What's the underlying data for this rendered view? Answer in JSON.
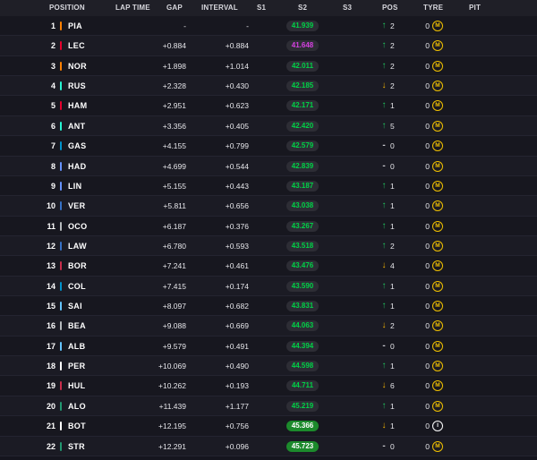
{
  "header": {
    "position": "POSITION",
    "lap_time": "LAP TIME",
    "gap": "GAP",
    "interval": "INTERVAL",
    "s1": "S1",
    "s2": "S2",
    "s3": "S3",
    "pos": "POS",
    "tyre": "TYRE",
    "pit": "PIT"
  },
  "colors": {
    "background": "#15151e",
    "accent": "#e10600",
    "sector_green": "#00d247",
    "sector_purple": "#d440e0",
    "up": "#21c25e",
    "down": "#f5b400",
    "tyre_medium": "#f2c200"
  },
  "rows": [
    {
      "pos": "1",
      "driver": "PIA",
      "team_color": "#ff8000",
      "gap": "-",
      "interval": "-",
      "s2": "41.939",
      "s2_style": "green",
      "dir": "up",
      "arrow": "↑",
      "pos_change": "2",
      "tyre_age": "0",
      "tyre": "M",
      "tyre_icon": "medium-tyre-icon"
    },
    {
      "pos": "2",
      "driver": "LEC",
      "team_color": "#e8002d",
      "gap": "+0.884",
      "interval": "+0.884",
      "s2": "41.648",
      "s2_style": "purple",
      "dir": "up",
      "arrow": "↑",
      "pos_change": "2",
      "tyre_age": "0",
      "tyre": "M",
      "tyre_icon": "medium-tyre-icon"
    },
    {
      "pos": "3",
      "driver": "NOR",
      "team_color": "#ff8000",
      "gap": "+1.898",
      "interval": "+1.014",
      "s2": "42.011",
      "s2_style": "green",
      "dir": "up",
      "arrow": "↑",
      "pos_change": "2",
      "tyre_age": "0",
      "tyre": "M",
      "tyre_icon": "medium-tyre-icon"
    },
    {
      "pos": "4",
      "driver": "RUS",
      "team_color": "#27f4d2",
      "gap": "+2.328",
      "interval": "+0.430",
      "s2": "42.185",
      "s2_style": "green",
      "dir": "down",
      "arrow": "↓",
      "pos_change": "2",
      "tyre_age": "0",
      "tyre": "M",
      "tyre_icon": "medium-tyre-icon"
    },
    {
      "pos": "5",
      "driver": "HAM",
      "team_color": "#e8002d",
      "gap": "+2.951",
      "interval": "+0.623",
      "s2": "42.171",
      "s2_style": "green",
      "dir": "up",
      "arrow": "↑",
      "pos_change": "1",
      "tyre_age": "0",
      "tyre": "M",
      "tyre_icon": "medium-tyre-icon"
    },
    {
      "pos": "6",
      "driver": "ANT",
      "team_color": "#27f4d2",
      "gap": "+3.356",
      "interval": "+0.405",
      "s2": "42.420",
      "s2_style": "green",
      "dir": "up",
      "arrow": "↑",
      "pos_change": "5",
      "tyre_age": "0",
      "tyre": "M",
      "tyre_icon": "medium-tyre-icon"
    },
    {
      "pos": "7",
      "driver": "GAS",
      "team_color": "#0093cc",
      "gap": "+4.155",
      "interval": "+0.799",
      "s2": "42.579",
      "s2_style": "green",
      "dir": "none",
      "arrow": "-",
      "pos_change": "0",
      "tyre_age": "0",
      "tyre": "M",
      "tyre_icon": "medium-tyre-icon"
    },
    {
      "pos": "8",
      "driver": "HAD",
      "team_color": "#6692ff",
      "gap": "+4.699",
      "interval": "+0.544",
      "s2": "42.839",
      "s2_style": "green",
      "dir": "none",
      "arrow": "-",
      "pos_change": "0",
      "tyre_age": "0",
      "tyre": "M",
      "tyre_icon": "medium-tyre-icon"
    },
    {
      "pos": "9",
      "driver": "LIN",
      "team_color": "#6692ff",
      "gap": "+5.155",
      "interval": "+0.443",
      "s2": "43.187",
      "s2_style": "green",
      "dir": "up",
      "arrow": "↑",
      "pos_change": "1",
      "tyre_age": "0",
      "tyre": "M",
      "tyre_icon": "medium-tyre-icon"
    },
    {
      "pos": "10",
      "driver": "VER",
      "team_color": "#3671c6",
      "gap": "+5.811",
      "interval": "+0.656",
      "s2": "43.038",
      "s2_style": "green",
      "dir": "up",
      "arrow": "↑",
      "pos_change": "1",
      "tyre_age": "0",
      "tyre": "M",
      "tyre_icon": "medium-tyre-icon"
    },
    {
      "pos": "11",
      "driver": "OCO",
      "team_color": "#b6babd",
      "gap": "+6.187",
      "interval": "+0.376",
      "s2": "43.267",
      "s2_style": "green",
      "dir": "up",
      "arrow": "↑",
      "pos_change": "1",
      "tyre_age": "0",
      "tyre": "M",
      "tyre_icon": "medium-tyre-icon"
    },
    {
      "pos": "12",
      "driver": "LAW",
      "team_color": "#3671c6",
      "gap": "+6.780",
      "interval": "+0.593",
      "s2": "43.518",
      "s2_style": "green",
      "dir": "up",
      "arrow": "↑",
      "pos_change": "2",
      "tyre_age": "0",
      "tyre": "M",
      "tyre_icon": "medium-tyre-icon"
    },
    {
      "pos": "13",
      "driver": "BOR",
      "team_color": "#c92d4b",
      "gap": "+7.241",
      "interval": "+0.461",
      "s2": "43.476",
      "s2_style": "green",
      "dir": "down",
      "arrow": "↓",
      "pos_change": "4",
      "tyre_age": "0",
      "tyre": "M",
      "tyre_icon": "medium-tyre-icon"
    },
    {
      "pos": "14",
      "driver": "COL",
      "team_color": "#0093cc",
      "gap": "+7.415",
      "interval": "+0.174",
      "s2": "43.590",
      "s2_style": "green",
      "dir": "up",
      "arrow": "↑",
      "pos_change": "1",
      "tyre_age": "0",
      "tyre": "M",
      "tyre_icon": "medium-tyre-icon"
    },
    {
      "pos": "15",
      "driver": "SAI",
      "team_color": "#64c4ff",
      "gap": "+8.097",
      "interval": "+0.682",
      "s2": "43.831",
      "s2_style": "green",
      "dir": "up",
      "arrow": "↑",
      "pos_change": "1",
      "tyre_age": "0",
      "tyre": "M",
      "tyre_icon": "medium-tyre-icon"
    },
    {
      "pos": "16",
      "driver": "BEA",
      "team_color": "#b6babd",
      "gap": "+9.088",
      "interval": "+0.669",
      "s2": "44.063",
      "s2_style": "green",
      "dir": "down",
      "arrow": "↓",
      "pos_change": "2",
      "tyre_age": "0",
      "tyre": "M",
      "tyre_icon": "medium-tyre-icon"
    },
    {
      "pos": "17",
      "driver": "ALB",
      "team_color": "#64c4ff",
      "gap": "+9.579",
      "interval": "+0.491",
      "s2": "44.394",
      "s2_style": "green",
      "dir": "none",
      "arrow": "-",
      "pos_change": "0",
      "tyre_age": "0",
      "tyre": "M",
      "tyre_icon": "medium-tyre-icon"
    },
    {
      "pos": "18",
      "driver": "PER",
      "team_color": "#ffffff",
      "gap": "+10.069",
      "interval": "+0.490",
      "s2": "44.598",
      "s2_style": "green",
      "dir": "up",
      "arrow": "↑",
      "pos_change": "1",
      "tyre_age": "0",
      "tyre": "M",
      "tyre_icon": "medium-tyre-icon"
    },
    {
      "pos": "19",
      "driver": "HUL",
      "team_color": "#c92d4b",
      "gap": "+10.262",
      "interval": "+0.193",
      "s2": "44.711",
      "s2_style": "green",
      "dir": "down",
      "arrow": "↓",
      "pos_change": "6",
      "tyre_age": "0",
      "tyre": "M",
      "tyre_icon": "medium-tyre-icon"
    },
    {
      "pos": "20",
      "driver": "ALO",
      "team_color": "#229971",
      "gap": "+11.439",
      "interval": "+1.177",
      "s2": "45.219",
      "s2_style": "green",
      "dir": "up",
      "arrow": "↑",
      "pos_change": "1",
      "tyre_age": "0",
      "tyre": "M",
      "tyre_icon": "medium-tyre-icon"
    },
    {
      "pos": "21",
      "driver": "BOT",
      "team_color": "#ffffff",
      "gap": "+12.195",
      "interval": "+0.756",
      "s2": "45.366",
      "s2_style": "bright",
      "dir": "down",
      "arrow": "↓",
      "pos_change": "1",
      "tyre_age": "0",
      "tyre": "I",
      "tyre_icon": "intermediate-tyre-icon"
    },
    {
      "pos": "22",
      "driver": "STR",
      "team_color": "#229971",
      "gap": "+12.291",
      "interval": "+0.096",
      "s2": "45.723",
      "s2_style": "bright",
      "dir": "none",
      "arrow": "-",
      "pos_change": "0",
      "tyre_age": "0",
      "tyre": "M",
      "tyre_icon": "medium-tyre-icon"
    }
  ]
}
